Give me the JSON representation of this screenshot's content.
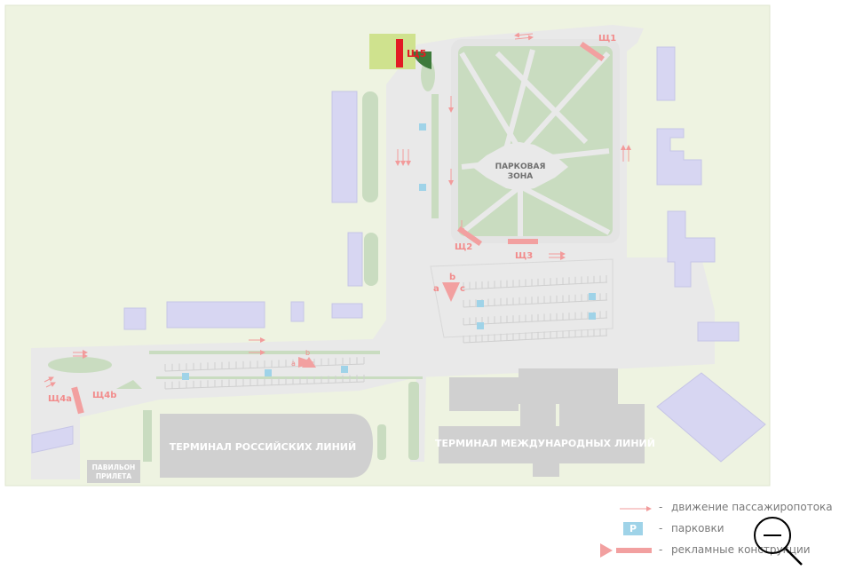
{
  "colors": {
    "area": "#eef3e1",
    "road": "#e9e9e9",
    "building": "#d7d6f2",
    "building_stroke": "#c6c5e6",
    "green": "#c9dcc0",
    "terminal": "#cfcfcf",
    "ad": "#f2a0a0",
    "ad_active": "#e21b23",
    "park_lightgreen": "#cfe28e",
    "park_darkgreen": "#3e7a3b",
    "parking": "#9fd3e8"
  },
  "map": {
    "park_zone": [
      "ПАРКОВАЯ",
      "ЗОНА"
    ],
    "terminal_ru": "ТЕРМИНАЛ РОССИЙСКИХ ЛИНИЙ",
    "terminal_int": "ТЕРМИНАЛ МЕЖДУНАРОДНЫХ ЛИНИЙ",
    "pavilion": [
      "ПАВИЛЬОН",
      "ПРИЛЕТА"
    ],
    "ad_labels": {
      "sh1": "Щ1",
      "sh2": "Щ2",
      "sh3": "Щ3",
      "sh4a": "Щ4a",
      "sh4b": "Щ4b",
      "sh5": "Щ5",
      "a": "a",
      "b": "b",
      "c": "c"
    },
    "parking_symbol": "P"
  },
  "legend": {
    "dash": "-",
    "flow": "движение пассажиропотока",
    "parking": "парковки",
    "ads": "рекламные конструкции"
  },
  "icons": {
    "zoom": "zoom-out-icon"
  }
}
